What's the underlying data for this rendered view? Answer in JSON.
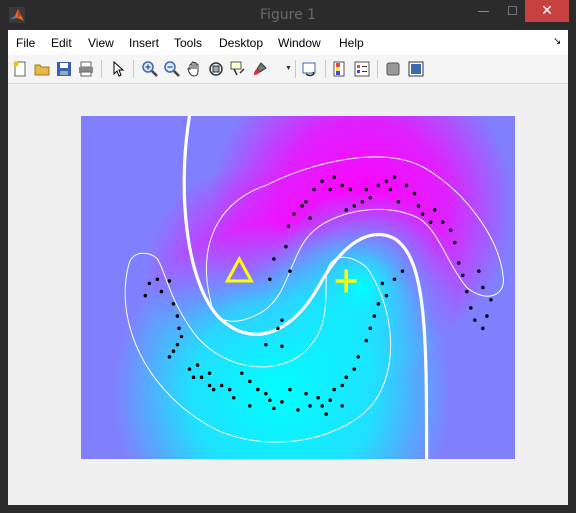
{
  "window": {
    "title": "Figure 1",
    "min_symbol": "—",
    "max_symbol": "☐",
    "close_symbol": "✕"
  },
  "menu": [
    "File",
    "Edit",
    "View",
    "Insert",
    "Tools",
    "Desktop",
    "Window",
    "Help"
  ],
  "menu_end_symbol": "↘",
  "toolbar": [
    "new-figure",
    "open-file",
    "save-figure",
    "print-figure",
    "edit-plot",
    "zoom-in",
    "zoom-out",
    "pan",
    "rotate-3d",
    "data-cursor",
    "brush",
    "link-plot",
    "insert-colorbar",
    "insert-legend",
    "hide-plot-tools",
    "show-plot-tools"
  ],
  "plot": {
    "colors": {
      "background": "#8080ff",
      "magenta": "#ff00ff",
      "cyan": "#00ffff",
      "contour": "#ffffff",
      "points": "#000000",
      "markers": "#ffff00"
    },
    "markers": {
      "triangle": "triangle",
      "plus": "plus"
    },
    "points": [
      [
        -1.9,
        -0.1
      ],
      [
        -1.85,
        0.05
      ],
      [
        -1.75,
        0.1
      ],
      [
        -1.7,
        -0.05
      ],
      [
        -1.6,
        0.08
      ],
      [
        -1.55,
        -0.2
      ],
      [
        -1.5,
        -0.35
      ],
      [
        -1.48,
        -0.5
      ],
      [
        -1.45,
        -0.6
      ],
      [
        -1.5,
        -0.7
      ],
      [
        -1.55,
        -0.78
      ],
      [
        -1.6,
        -0.85
      ],
      [
        -1.35,
        -1.0
      ],
      [
        -1.2,
        -1.1
      ],
      [
        -1.1,
        -1.05
      ],
      [
        -1.05,
        -1.25
      ],
      [
        -0.95,
        -1.2
      ],
      [
        -0.85,
        -1.25
      ],
      [
        -0.7,
        -1.05
      ],
      [
        -0.6,
        -1.15
      ],
      [
        -0.5,
        -1.25
      ],
      [
        -0.4,
        -1.3
      ],
      [
        -0.35,
        -1.38
      ],
      [
        -0.3,
        -1.48
      ],
      [
        -0.2,
        -1.4
      ],
      [
        -0.1,
        -1.25
      ],
      [
        0.1,
        -1.3
      ],
      [
        0.15,
        -1.45
      ],
      [
        0.25,
        -1.35
      ],
      [
        0.3,
        -1.45
      ],
      [
        0.4,
        -1.38
      ],
      [
        0.45,
        -1.25
      ],
      [
        0.55,
        -1.2
      ],
      [
        0.6,
        -1.1
      ],
      [
        0.7,
        -1.0
      ],
      [
        0.75,
        -0.85
      ],
      [
        0.85,
        -0.65
      ],
      [
        0.9,
        -0.5
      ],
      [
        0.95,
        -0.35
      ],
      [
        1.0,
        -0.2
      ],
      [
        1.1,
        -0.1
      ],
      [
        1.2,
        0.1
      ],
      [
        1.3,
        0.2
      ],
      [
        1.05,
        0.05
      ],
      [
        0.55,
        -1.45
      ],
      [
        0.35,
        -1.55
      ],
      [
        0.0,
        -1.5
      ],
      [
        -0.6,
        -1.45
      ],
      [
        -0.8,
        -1.35
      ],
      [
        -1.25,
        -0.95
      ],
      [
        -1.3,
        -1.1
      ],
      [
        -1.1,
        -1.2
      ],
      [
        -0.2,
        -0.4
      ],
      [
        -0.25,
        -0.5
      ],
      [
        -0.4,
        -0.7
      ],
      [
        -0.2,
        -0.72
      ],
      [
        -0.35,
        0.1
      ],
      [
        -0.1,
        0.2
      ],
      [
        -0.3,
        0.35
      ],
      [
        -0.15,
        0.5
      ],
      [
        -0.12,
        0.75
      ],
      [
        -0.05,
        0.9
      ],
      [
        0.05,
        1.0
      ],
      [
        0.1,
        1.05
      ],
      [
        0.2,
        1.2
      ],
      [
        0.3,
        1.3
      ],
      [
        0.4,
        1.2
      ],
      [
        0.45,
        1.35
      ],
      [
        0.55,
        1.25
      ],
      [
        0.65,
        1.2
      ],
      [
        0.7,
        1.0
      ],
      [
        0.8,
        1.05
      ],
      [
        0.85,
        1.2
      ],
      [
        1.0,
        1.25
      ],
      [
        1.1,
        1.3
      ],
      [
        1.15,
        1.2
      ],
      [
        1.2,
        1.35
      ],
      [
        1.35,
        1.25
      ],
      [
        1.45,
        1.15
      ],
      [
        1.5,
        1.0
      ],
      [
        1.55,
        0.9
      ],
      [
        1.7,
        0.95
      ],
      [
        1.8,
        0.8
      ],
      [
        1.9,
        0.7
      ],
      [
        1.95,
        0.55
      ],
      [
        2.0,
        0.3
      ],
      [
        2.05,
        0.15
      ],
      [
        2.1,
        -0.05
      ],
      [
        2.15,
        -0.25
      ],
      [
        2.2,
        -0.4
      ],
      [
        2.3,
        -0.5
      ],
      [
        2.35,
        -0.35
      ],
      [
        2.4,
        -0.15
      ],
      [
        2.3,
        0.0
      ],
      [
        2.25,
        0.2
      ],
      [
        1.65,
        0.8
      ],
      [
        0.15,
        0.85
      ],
      [
        0.9,
        1.1
      ],
      [
        1.25,
        1.05
      ],
      [
        0.6,
        0.95
      ]
    ]
  }
}
